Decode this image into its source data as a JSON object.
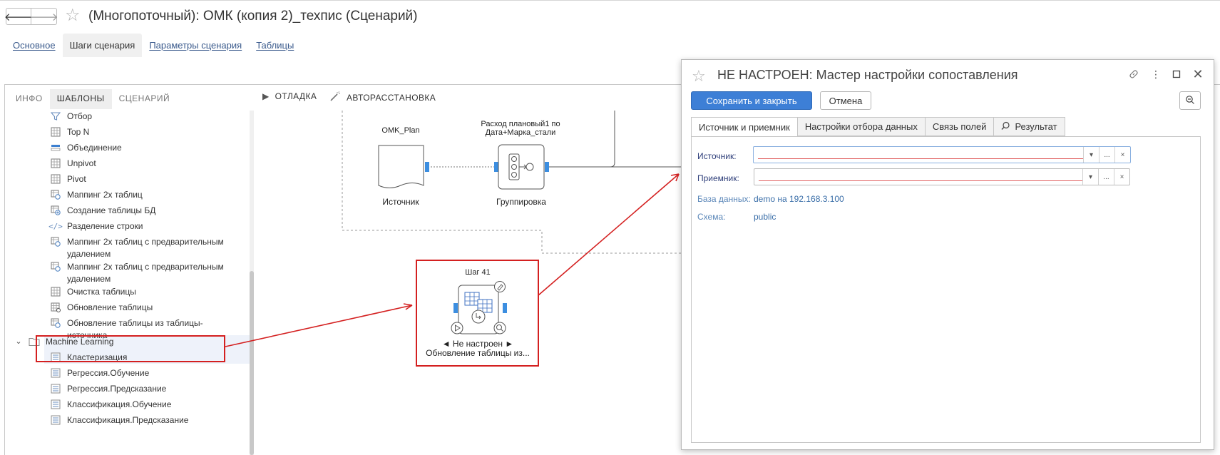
{
  "window": {
    "title": "(Многопоточный): ОМК (копия 2)_техпис (Сценарий)",
    "back_glyph": "🡐",
    "forward_glyph": "🡒"
  },
  "top_tabs": [
    {
      "label": "Основное",
      "active": false
    },
    {
      "label": "Шаги сценария",
      "active": true
    },
    {
      "label": "Параметры сценария",
      "active": false
    },
    {
      "label": "Таблицы",
      "active": false
    }
  ],
  "left_tabs": [
    {
      "label": "ИНФО",
      "active": false
    },
    {
      "label": "ШАБЛОНЫ",
      "active": true
    },
    {
      "label": "СЦЕНАРИЙ",
      "active": false
    }
  ],
  "tree": {
    "items": [
      {
        "label": "Отбор",
        "icon": "filter-icon"
      },
      {
        "label": "Top N",
        "icon": "table-icon"
      },
      {
        "label": "Объединение",
        "icon": "union-icon"
      },
      {
        "label": "Unpivot",
        "icon": "table-icon"
      },
      {
        "label": "Pivot",
        "icon": "table-icon"
      },
      {
        "label": "Маппинг 2х таблиц",
        "icon": "mapping-icon"
      },
      {
        "label": "Создание таблицы БД",
        "icon": "create-table-icon"
      },
      {
        "label": "Разделение строки",
        "icon": "code-icon"
      },
      {
        "label": "Маппинг 2х таблиц с предварительным",
        "label2": "удалением",
        "icon": "mapping-icon"
      },
      {
        "label": "Маппинг 2х таблиц с предварительным",
        "label2": "удалением",
        "icon": "mapping-icon"
      },
      {
        "label": "Очистка таблицы",
        "icon": "table-icon"
      },
      {
        "label": "Обновление таблицы",
        "icon": "table-icon"
      },
      {
        "label": "Обновление таблицы из таблицы-",
        "label2": "источника",
        "icon": "mapping-icon"
      }
    ],
    "folder": {
      "label": "Machine Learning",
      "chevron": "⌄"
    },
    "ml_items": [
      {
        "label": "Кластеризация"
      },
      {
        "label": "Регрессия.Обучение"
      },
      {
        "label": "Регрессия.Предсказание"
      },
      {
        "label": "Классификация.Обучение"
      },
      {
        "label": "Классификация.Предсказание"
      }
    ]
  },
  "toolbar": {
    "debug_label": "ОТЛАДКА",
    "auto_label": "АВТОРАССТАНОВКА"
  },
  "canvas": {
    "node1": {
      "caption": "OMK_Plan",
      "name": "Источник"
    },
    "node2": {
      "caption_line1": "Расход плановый1 по",
      "caption_line2": "Дата+Марка_стали",
      "name": "Группировка"
    },
    "node3": {
      "caption": "Шаг 41",
      "status": "◄ Не настроен ►",
      "name": "Обновление таблицы из..."
    }
  },
  "dialog": {
    "title": "НЕ НАСТРОЕН: Мастер настройки сопоставления",
    "save_label": "Сохранить и закрыть",
    "cancel_label": "Отмена",
    "tabs": [
      {
        "label": "Источник и приемник",
        "active": true
      },
      {
        "label": "Настройки отбора данных",
        "active": false
      },
      {
        "label": "Связь полей",
        "active": false
      },
      {
        "label": "Результат",
        "active": false
      }
    ],
    "source_label": "Источник:",
    "target_label": "Приемник:",
    "db_label": "База данных:",
    "db_value": "demo на 192.168.3.100",
    "schema_label": "Схема:",
    "schema_value": "public",
    "dropdown_glyph": "▾",
    "more_glyph": "...",
    "clear_glyph": "×"
  },
  "colors": {
    "accent": "#3d7fd6",
    "highlight_box": "#d42020",
    "port": "#3c8ee0"
  }
}
